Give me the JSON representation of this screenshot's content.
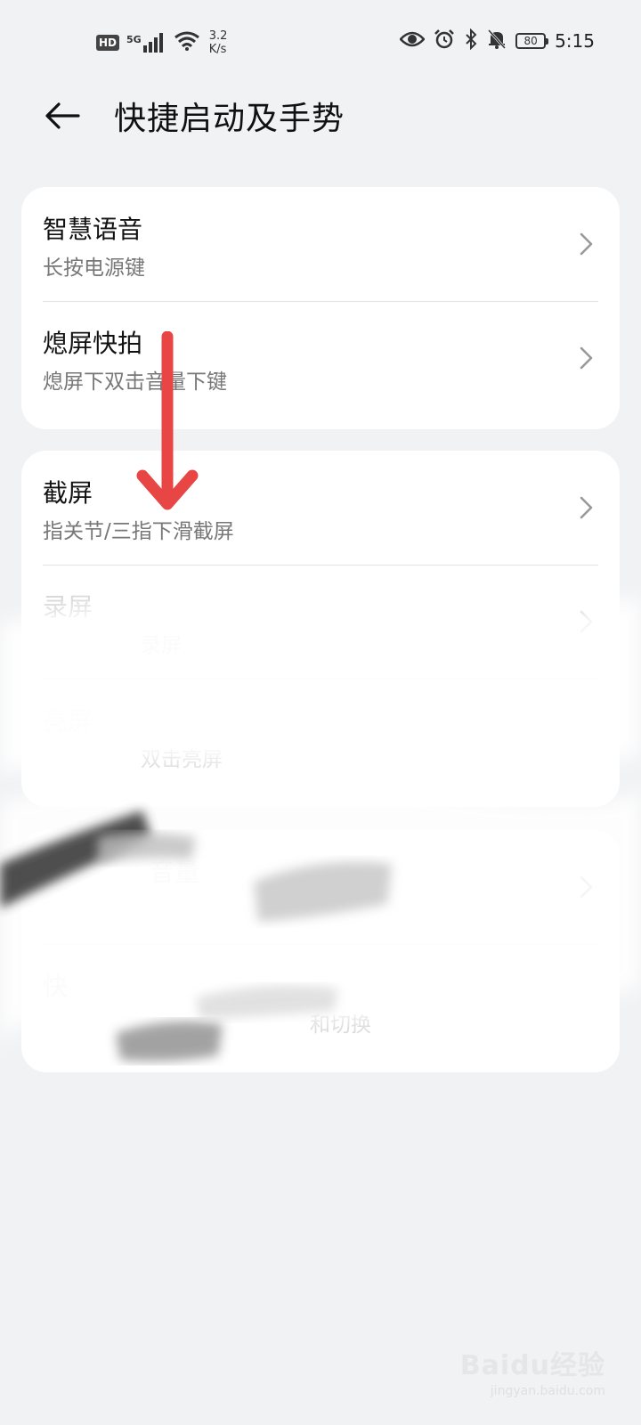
{
  "status_bar": {
    "hd": "HD",
    "network": "5G",
    "speed_value": "3.2",
    "speed_unit": "K/s",
    "battery": "80",
    "time": "5:15"
  },
  "header": {
    "title": "快捷启动及手势"
  },
  "groups": [
    {
      "items": [
        {
          "title": "智慧语音",
          "subtitle": "长按电源键"
        },
        {
          "title": "熄屏快拍",
          "subtitle": "熄屏下双击音量下键"
        }
      ]
    },
    {
      "items": [
        {
          "title": "截屏",
          "subtitle": "指关节/三指下滑截屏"
        },
        {
          "title": "录屏",
          "subtitle": "录屏"
        },
        {
          "title": "亮屏",
          "subtitle": "双击亮屏"
        }
      ]
    },
    {
      "items": [
        {
          "title": "音量",
          "subtitle": ""
        },
        {
          "title": "快",
          "subtitle": "和切换"
        }
      ]
    }
  ],
  "watermark": {
    "logo": "Baidu经验",
    "url": "jingyan.baidu.com"
  },
  "colors": {
    "background": "#f1f2f4",
    "card": "#ffffff",
    "annotation_arrow": "#e84545"
  }
}
